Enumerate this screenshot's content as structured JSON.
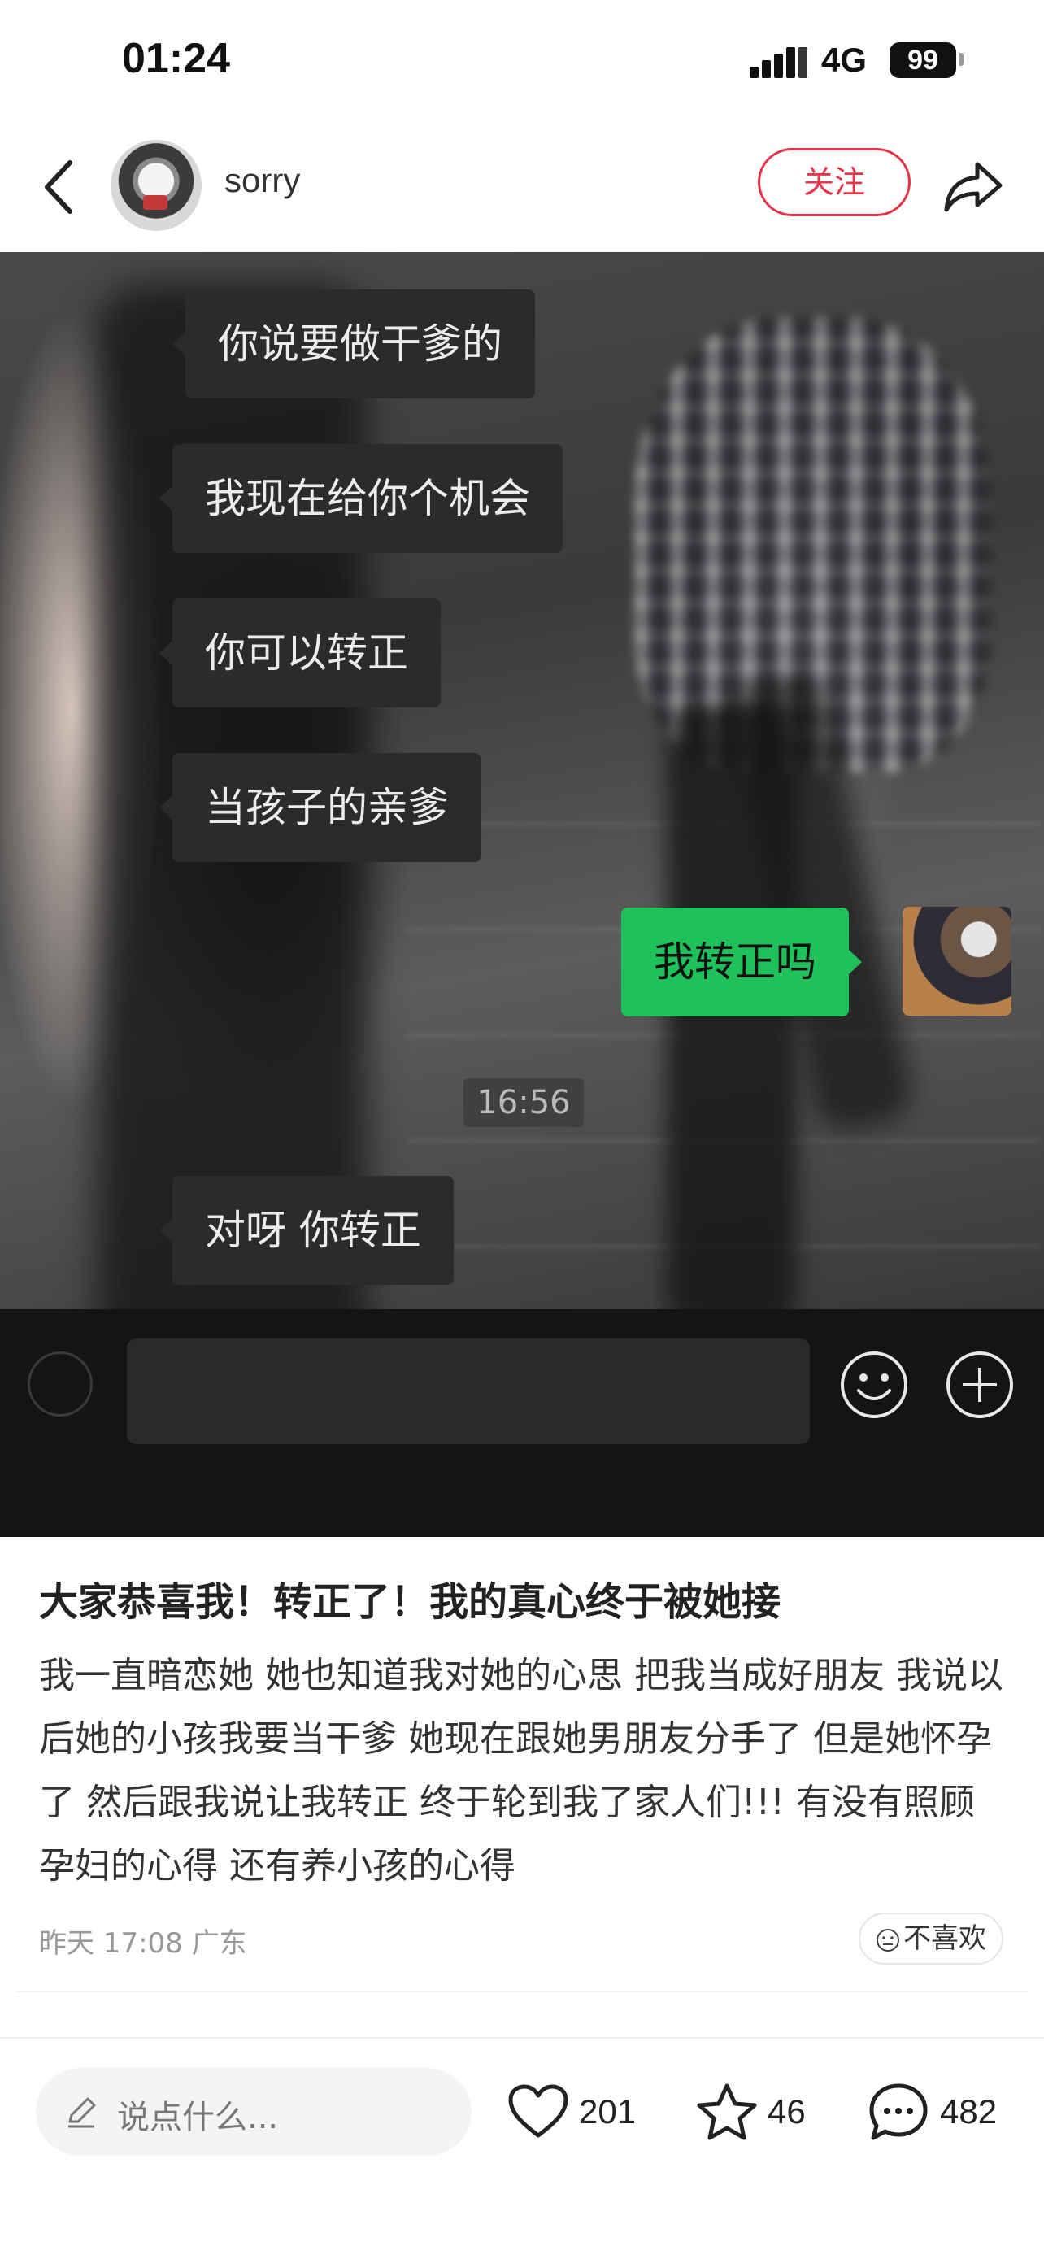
{
  "status_bar": {
    "time": "01:24",
    "network": "4G",
    "battery": "99"
  },
  "header": {
    "username": "sorry",
    "follow_label": "关注"
  },
  "chat": {
    "messages": [
      {
        "text": "你说要做干爹的",
        "side": "left"
      },
      {
        "text": "我现在给你个机会",
        "side": "left"
      },
      {
        "text": "你可以转正",
        "side": "left"
      },
      {
        "text": "当孩子的亲爹",
        "side": "left"
      },
      {
        "text": "我转正吗",
        "side": "right"
      },
      {
        "text": "对呀 你转正",
        "side": "left"
      }
    ],
    "timestamp": "16:56"
  },
  "post": {
    "title": "大家恭喜我！转正了！我的真心终于被她接",
    "body": "我一直暗恋她 她也知道我对她的心思 把我当成好朋友 我说以后她的小孩我要当干爹 她现在跟她男朋友分手了 但是她怀孕了 然后跟我说让我转正 终于轮到我了家人们!!! 有没有照顾孕妇的心得 还有养小孩的心得",
    "meta": "昨天 17:08 广东",
    "dislike_label": "不喜欢"
  },
  "bottom_bar": {
    "comment_placeholder": "说点什么...",
    "likes": "201",
    "favorites": "46",
    "comments": "482"
  },
  "colors": {
    "accent": "#e8344a",
    "chat_me": "#1fc15a",
    "chat_other": "#2b2b2b"
  }
}
